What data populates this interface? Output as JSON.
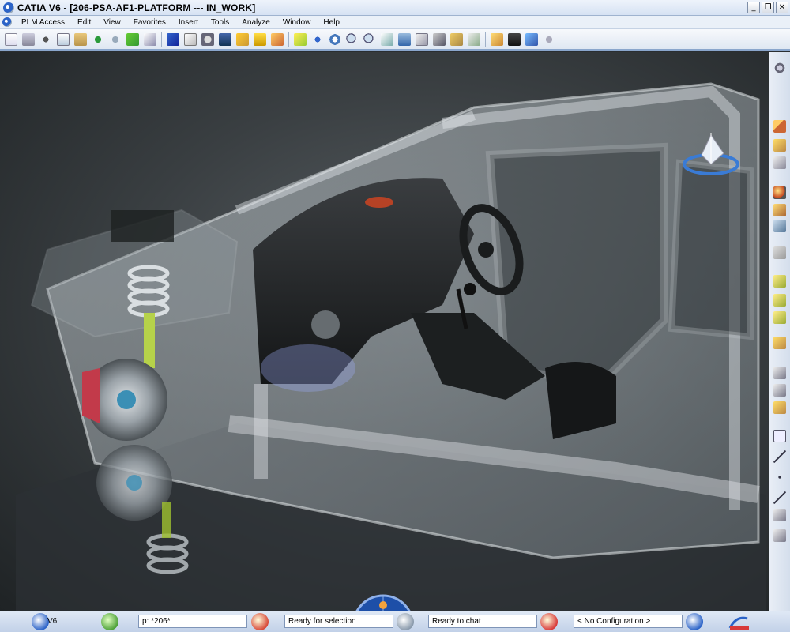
{
  "window": {
    "title": "CATIA V6 - [206-PSA-AF1-PLATFORM --- IN_WORK]",
    "buttons": [
      "_",
      "❐",
      "✕"
    ]
  },
  "menu": {
    "items": [
      "PLM Access",
      "Edit",
      "View",
      "Favorites",
      "Insert",
      "Tools",
      "Analyze",
      "Window",
      "Help"
    ]
  },
  "status": {
    "v6_label": "V6",
    "search_field": "p: *206*",
    "selection_field": "Ready for selection",
    "chat_field": "Ready to chat",
    "configuration_field": "< No Configuration >"
  },
  "colors": {
    "accent": "#2b63c8",
    "titlebar": "#d6e2f3",
    "viewport_bg": "#3a3f42"
  }
}
